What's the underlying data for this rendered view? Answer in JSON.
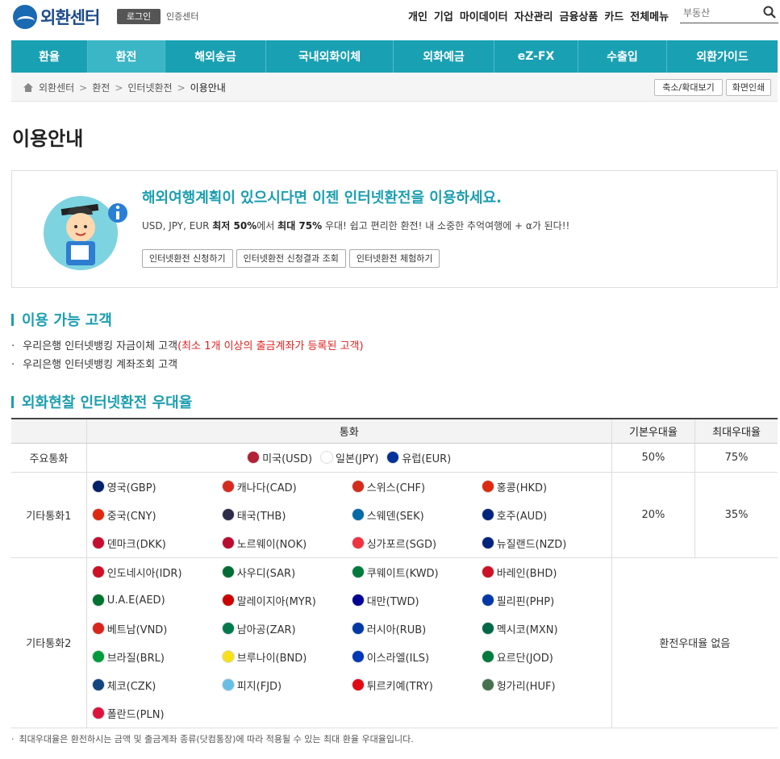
{
  "header": {
    "logo_text": "외환센터",
    "login_label": "로그인",
    "cert_label": "인증센터",
    "gnb": [
      "개인",
      "기업",
      "마이데이터",
      "자산관리",
      "금융상품",
      "카드",
      "전체메뉴"
    ],
    "search_placeholder": "부동산"
  },
  "nav": {
    "items": [
      "환율",
      "환전",
      "해외송금",
      "국내외화이체",
      "외화예금",
      "eZ-FX",
      "수출입",
      "외환가이드"
    ],
    "active": "환전"
  },
  "breadcrumb": [
    "외환센터",
    "환전",
    "인터넷환전",
    "이용안내"
  ],
  "tools": {
    "zoom_label": "축소/확대보기",
    "print_label": "화면인쇄"
  },
  "page_title": "이용안내",
  "promo": {
    "heading": "해외여행계획이 있으시다면 이젠 인터넷환전을 이용하세요.",
    "text_prefix": "USD, JPY, EUR ",
    "text_b1": "최저 50%",
    "text_mid": "에서 ",
    "text_b2": "최대 75%",
    "text_suffix": " 우대! 쉽고 편리한 환전! 내 소중한 추억여행에 + α가 된다!!",
    "buttons": [
      "인터넷환전 신청하기",
      "인터넷환전 신청결과 조회",
      "인터넷환전 체험하기"
    ]
  },
  "section1": {
    "title": "이용 가능 고객",
    "bullet1_main": "우리은행 인터넷뱅킹 자금이체 고객",
    "bullet1_red": "(최소 1개 이상의 출금계좌가 등록된 고객)",
    "bullet2": "우리은행 인터넷뱅킹 계좌조회 고객"
  },
  "section2": {
    "title": "외화현찰 인터넷환전 우대율"
  },
  "table": {
    "headers": [
      "",
      "통화",
      "기본우대율",
      "최대우대율"
    ],
    "rows": [
      {
        "type": "주요통화",
        "basic": "50%",
        "max": "75%",
        "currencies": [
          {
            "label": "미국(USD)",
            "flag": "#b22234"
          },
          {
            "label": "일본(JPY)",
            "flag": "#ffffff"
          },
          {
            "label": "유럽(EUR)",
            "flag": "#003399"
          }
        ]
      },
      {
        "type": "기타통화1",
        "basic": "20%",
        "max": "35%",
        "currencies": [
          {
            "label": "영국(GBP)",
            "flag": "#012169"
          },
          {
            "label": "캐나다(CAD)",
            "flag": "#d52b1e"
          },
          {
            "label": "스위스(CHF)",
            "flag": "#d52b1e"
          },
          {
            "label": "홍콩(HKD)",
            "flag": "#de2910"
          },
          {
            "label": "중국(CNY)",
            "flag": "#de2910"
          },
          {
            "label": "태국(THB)",
            "flag": "#2d2a4a"
          },
          {
            "label": "스웨덴(SEK)",
            "flag": "#006aa7"
          },
          {
            "label": "호주(AUD)",
            "flag": "#00247d"
          },
          {
            "label": "덴마크(DKK)",
            "flag": "#c60c30"
          },
          {
            "label": "노르웨이(NOK)",
            "flag": "#ba0c2f"
          },
          {
            "label": "싱가포르(SGD)",
            "flag": "#ef3340"
          },
          {
            "label": "뉴질랜드(NZD)",
            "flag": "#00247d"
          }
        ]
      },
      {
        "type": "기타통화2",
        "merged": "환전우대율 없음",
        "currencies": [
          {
            "label": "인도네시아(IDR)",
            "flag": "#ce1126"
          },
          {
            "label": "사우디(SAR)",
            "flag": "#006c35"
          },
          {
            "label": "쿠웨이트(KWD)",
            "flag": "#007a3d"
          },
          {
            "label": "바레인(BHD)",
            "flag": "#ce1126"
          },
          {
            "label": "U.A.E(AED)",
            "flag": "#00732f"
          },
          {
            "label": "말레이지아(MYR)",
            "flag": "#cc0001"
          },
          {
            "label": "대만(TWD)",
            "flag": "#000095"
          },
          {
            "label": "필리핀(PHP)",
            "flag": "#0038a8"
          },
          {
            "label": "베트남(VND)",
            "flag": "#da251d"
          },
          {
            "label": "남아공(ZAR)",
            "flag": "#007a4d"
          },
          {
            "label": "러시아(RUB)",
            "flag": "#0039a6"
          },
          {
            "label": "멕시코(MXN)",
            "flag": "#006847"
          },
          {
            "label": "브라질(BRL)",
            "flag": "#009c3b"
          },
          {
            "label": "브루나이(BND)",
            "flag": "#f7e017"
          },
          {
            "label": "이스라엘(ILS)",
            "flag": "#0038b8"
          },
          {
            "label": "요르단(JOD)",
            "flag": "#007a3d"
          },
          {
            "label": "체코(CZK)",
            "flag": "#11457e"
          },
          {
            "label": "피지(FJD)",
            "flag": "#68bfe5"
          },
          {
            "label": "튀르키예(TRY)",
            "flag": "#e30a17"
          },
          {
            "label": "헝가리(HUF)",
            "flag": "#477050"
          },
          {
            "label": "폴란드(PLN)",
            "flag": "#dc143c"
          }
        ]
      }
    ]
  },
  "footnote": "최대우대율은 환전하시는 금액 및 출금계좌 종류(닷컴통장)에 따라 적용될 수 있는 최대 환율 우대율입니다.",
  "colors": {
    "accent": "#1aa0b3",
    "accent_text": "#1b9eb0",
    "red": "#e02020"
  }
}
